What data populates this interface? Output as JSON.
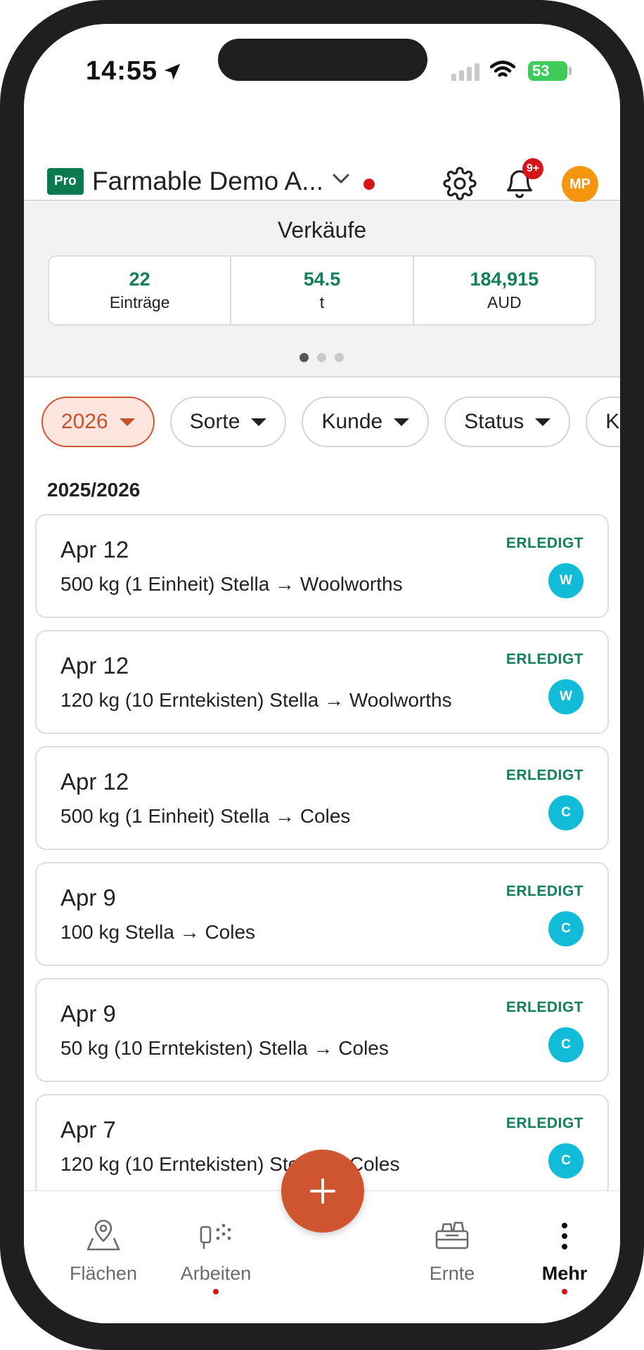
{
  "status_bar": {
    "time": "14:55",
    "battery": "53"
  },
  "header": {
    "badge": "Pro",
    "farm_name": "Farmable Demo A...",
    "notification_count": "9+",
    "avatar_initials": "MP"
  },
  "summary": {
    "title": "Verkäufe",
    "stats": [
      {
        "value": "22",
        "unit": "Einträge"
      },
      {
        "value": "54.5",
        "unit": "t"
      },
      {
        "value": "184,915",
        "unit": "AUD"
      }
    ],
    "pages": 3,
    "active_page": 1
  },
  "filters": [
    {
      "label": "2026",
      "active": true
    },
    {
      "label": "Sorte",
      "active": false
    },
    {
      "label": "Kunde",
      "active": false
    },
    {
      "label": "Status",
      "active": false
    },
    {
      "label": "Kult",
      "active": false
    }
  ],
  "season_label": "2025/2026",
  "entries": [
    {
      "date": "Apr 12",
      "description": "500 kg (1 Einheit) Stella → Woolworths",
      "status": "ERLEDIGT",
      "customer_initial": "W"
    },
    {
      "date": "Apr 12",
      "description": "120 kg (10 Erntekisten) Stella → Woolworths",
      "status": "ERLEDIGT",
      "customer_initial": "W"
    },
    {
      "date": "Apr 12",
      "description": "500 kg (1 Einheit) Stella → Coles",
      "status": "ERLEDIGT",
      "customer_initial": "C"
    },
    {
      "date": "Apr 9",
      "description": "100 kg Stella → Coles",
      "status": "ERLEDIGT",
      "customer_initial": "C"
    },
    {
      "date": "Apr 9",
      "description": "50 kg (10 Erntekisten) Stella → Coles",
      "status": "ERLEDIGT",
      "customer_initial": "C"
    },
    {
      "date": "Apr 7",
      "description": "120 kg (10 Erntekisten) Stella → Coles",
      "status": "ERLEDIGT",
      "customer_initial": "C"
    }
  ],
  "bottom_nav": [
    {
      "label": "Flächen",
      "icon": "map-pin-icon",
      "dot": false,
      "active": false
    },
    {
      "label": "Arbeiten",
      "icon": "spray-icon",
      "dot": true,
      "active": false
    },
    {
      "label": "Ernte",
      "icon": "harvest-crate-icon",
      "dot": false,
      "active": false
    },
    {
      "label": "Mehr",
      "icon": "more-vertical-icon",
      "dot": true,
      "active": true
    }
  ],
  "fab_icon": "plus-icon",
  "colors": {
    "brand_green": "#0b7a4f",
    "value_green": "#11805a",
    "accent_orange": "#cf5430",
    "avatar_orange": "#f4960f",
    "customer_cyan": "#12bcd9",
    "alert_red": "#d7141a"
  }
}
